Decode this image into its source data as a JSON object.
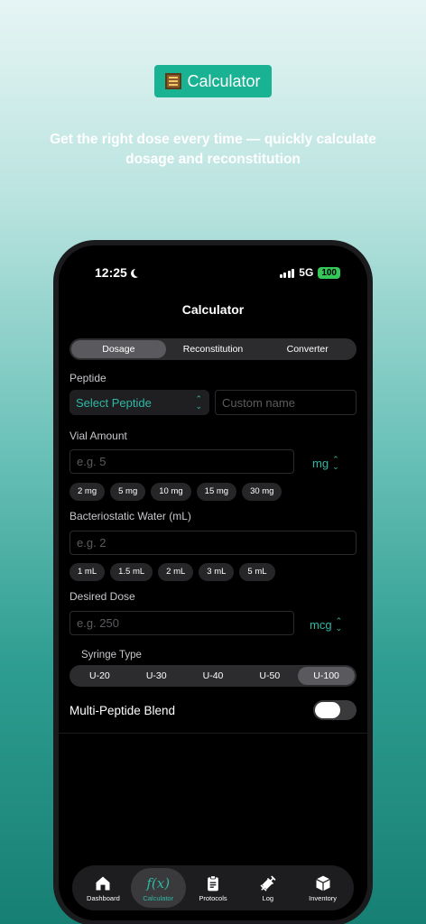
{
  "promo": {
    "badge_label": "Calculator",
    "headline": "Get the right dose every time — quickly calculate dosage and reconstitution"
  },
  "status_bar": {
    "time": "12:25",
    "network": "5G",
    "battery": "100"
  },
  "nav": {
    "title": "Calculator"
  },
  "mode_tabs": {
    "dosage": "Dosage",
    "reconstitution": "Reconstitution",
    "converter": "Converter",
    "selected": "Dosage"
  },
  "peptide": {
    "label": "Peptide",
    "select_value": "Select Peptide",
    "custom_placeholder": "Custom name"
  },
  "vial": {
    "label": "Vial Amount",
    "placeholder": "e.g. 5",
    "unit": "mg",
    "presets": [
      "2 mg",
      "5 mg",
      "10 mg",
      "15 mg",
      "30 mg"
    ]
  },
  "water": {
    "label": "Bacteriostatic Water (mL)",
    "placeholder": "e.g. 2",
    "presets": [
      "1 mL",
      "1.5 mL",
      "2 mL",
      "3 mL",
      "5 mL"
    ]
  },
  "dose": {
    "label": "Desired Dose",
    "placeholder": "e.g. 250",
    "unit": "mcg"
  },
  "syringe": {
    "label": "Syringe Type",
    "options": [
      "U-20",
      "U-30",
      "U-40",
      "U-50",
      "U-100"
    ],
    "selected": "U-100"
  },
  "blend": {
    "label": "Multi-Peptide Blend",
    "enabled": false
  },
  "tabbar": {
    "dashboard": "Dashboard",
    "calculator": "Calculator",
    "calculator_glyph": "f(x)",
    "protocols": "Protocols",
    "log": "Log",
    "inventory": "Inventory",
    "active": "Calculator"
  },
  "colors": {
    "accent": "#2fb8a5",
    "badge": "#19b394",
    "battery": "#34c759"
  }
}
